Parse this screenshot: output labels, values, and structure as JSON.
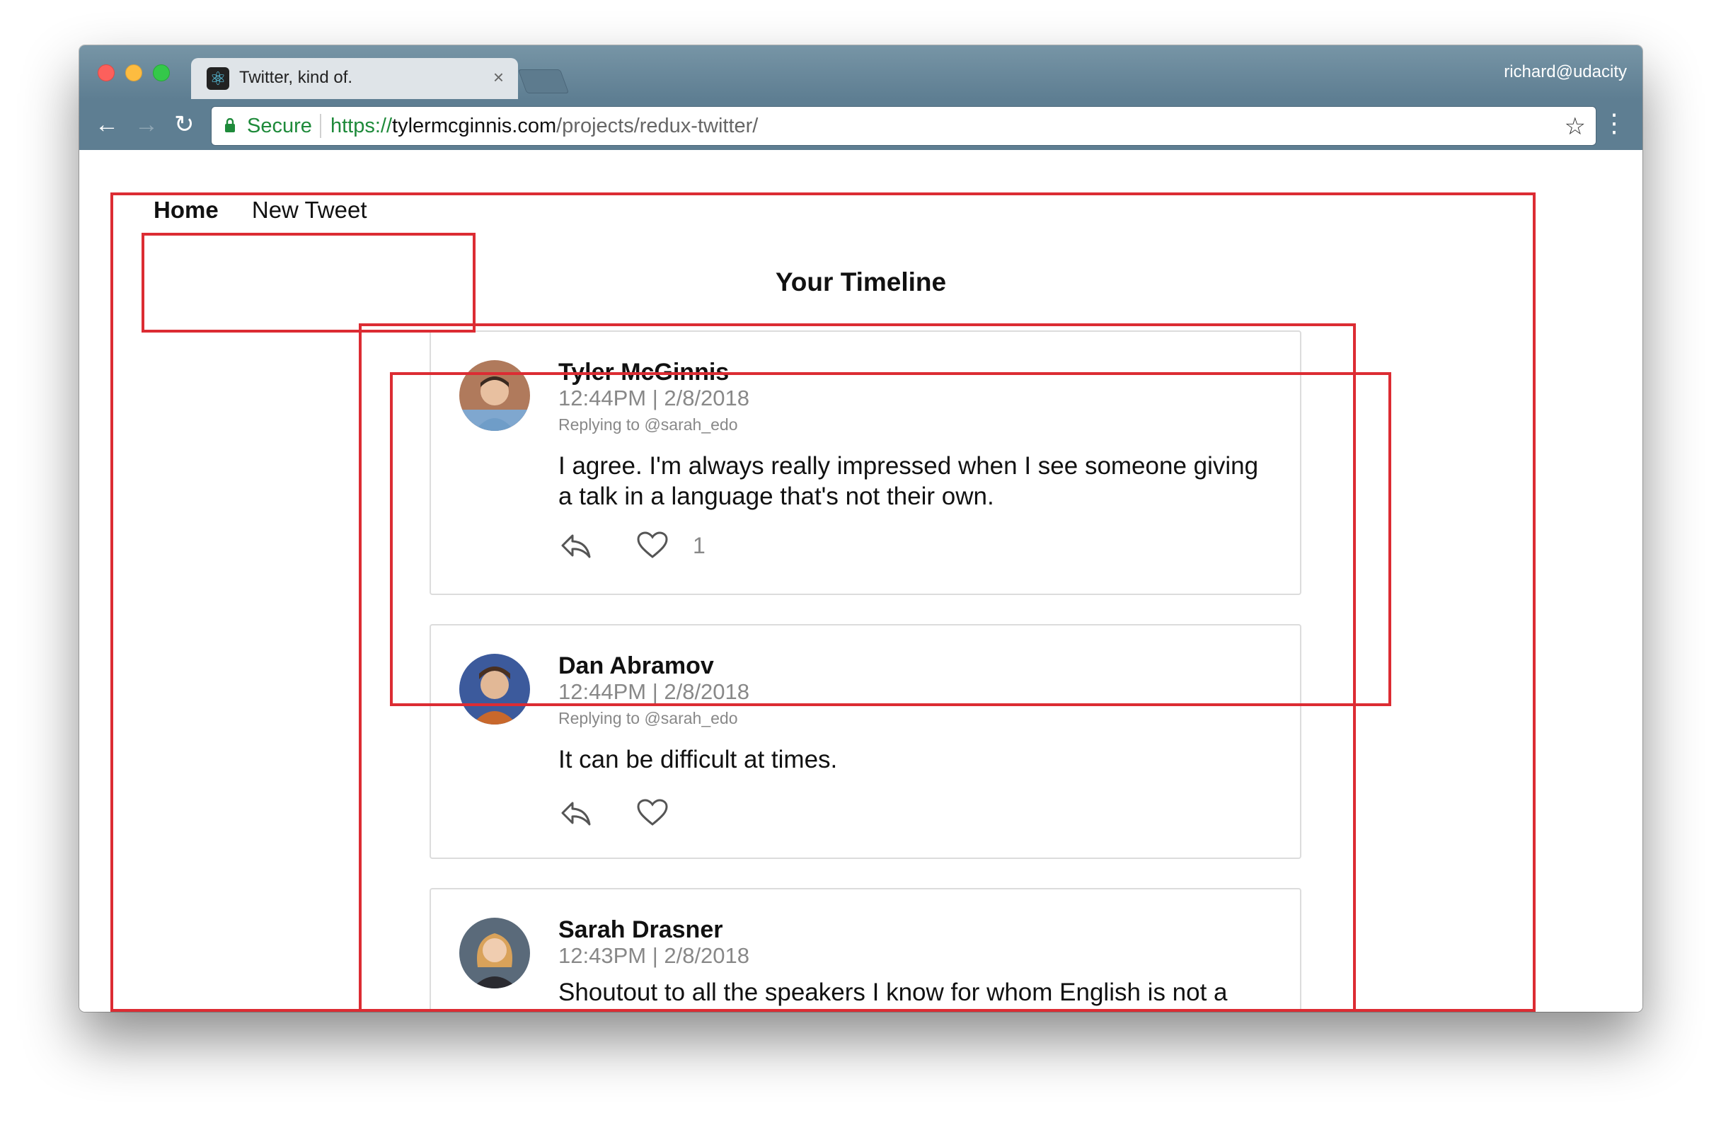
{
  "browser": {
    "tab_title": "Twitter, kind of.",
    "tab_close": "×",
    "profile": "richard@udacity",
    "secure_label": "Secure",
    "url_scheme": "https://",
    "url_host": "tylermcginnis.com",
    "url_path": "/projects/redux-twitter/"
  },
  "nav": {
    "home": "Home",
    "new_tweet": "New Tweet"
  },
  "timeline": {
    "title": "Your Timeline",
    "tweets": [
      {
        "author": "Tyler McGinnis",
        "time": "12:44PM | 2/8/2018",
        "replying_to": "Replying to @sarah_edo",
        "text": "I agree. I'm always really impressed when I see someone giving a talk in a language that's not their own.",
        "likes": "1"
      },
      {
        "author": "Dan Abramov",
        "time": "12:44PM | 2/8/2018",
        "replying_to": "Replying to @sarah_edo",
        "text": "It can be difficult at times.",
        "likes": ""
      },
      {
        "author": "Sarah Drasner",
        "time": "12:43PM | 2/8/2018",
        "text": "Shoutout to all the speakers I know for whom English is not a"
      }
    ]
  },
  "colors": {
    "annotation_red": "#dc2c33",
    "secure_green": "#1e8a3a",
    "chrome_bar": "#5e7e92"
  }
}
